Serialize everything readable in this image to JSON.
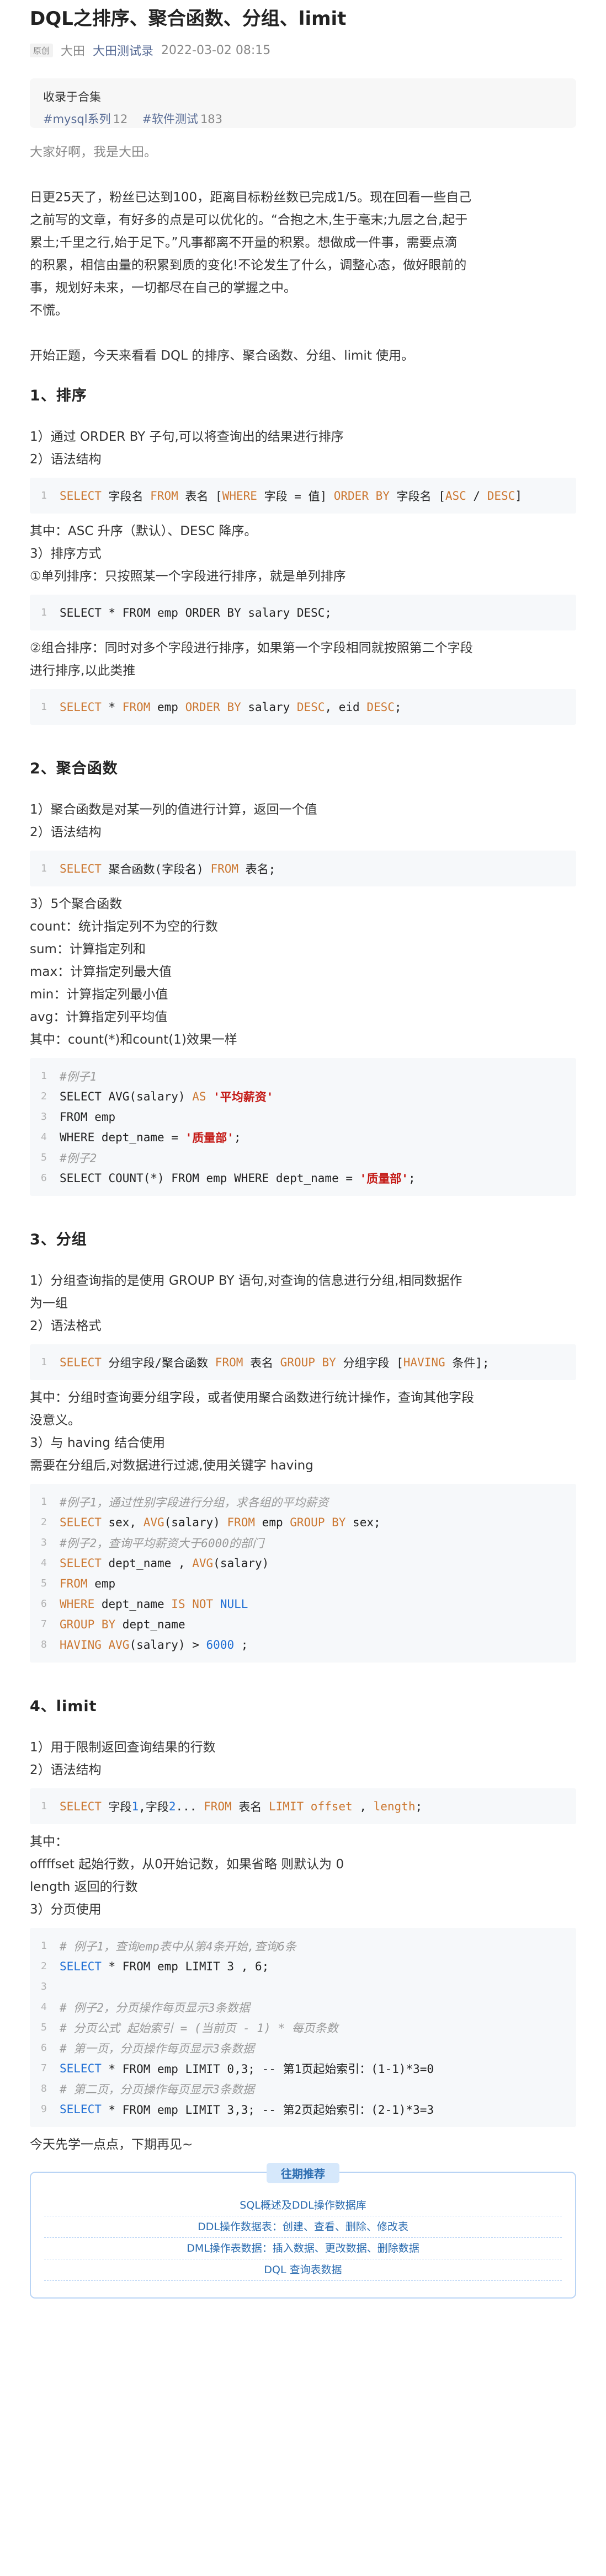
{
  "article": {
    "title": "DQL之排序、聚合函数、分组、limit",
    "badge": "原创",
    "author": "大田",
    "account": "大田测试录",
    "date": "2022-03-02 08:15"
  },
  "collection": {
    "label": "收录于合集",
    "tags": [
      {
        "name": "#mysql系列",
        "count": "12"
      },
      {
        "name": "#软件测试",
        "count": "183"
      }
    ]
  },
  "intro": {
    "greeting": "大家好啊，我是大田。",
    "para_lines": [
      "日更25天了，粉丝已达到100，距离目标粉丝数已完成1/5。现在回看一些自己",
      "之前写的文章，有好多的点是可以优化的。“合抱之木,生于毫末;九层之台,起于",
      "累土;千里之行,始于足下。”凡事都离不开量的积累。想做成一件事，需要点滴",
      "的积累，相信由量的积累到质的变化!不论发生了什么，调整心态，做好眼前的",
      "事，规划好未来，一切都尽在自己的掌握之中。"
    ],
    "closing": "不慌。",
    "start": "开始正题，今天来看看 DQL 的排序、聚合函数、分组、limit 使用。"
  },
  "s1": {
    "heading": "1、排序",
    "p1": "1）通过 ORDER BY 子句,可以将查询出的结果进行排序",
    "p2": "2）语法结构",
    "code1": {
      "n": "1",
      "a": "SELECT",
      "b": " 字段名 ",
      "c": "FROM",
      "d": " 表名 [",
      "e": "WHERE",
      "f": " 字段 = 值] ",
      "g": "ORDER BY",
      "h": " 字段名 [",
      "i": "ASC",
      "j": " / ",
      "k": "DESC",
      "l": "]"
    },
    "p3": "其中：ASC 升序（默认）、DESC 降序。",
    "p4": "3）排序方式",
    "p5": "①单列排序：只按照某一个字段进行排序，就是单列排序",
    "code2": {
      "n": "1",
      "a": "SELECT * FROM emp ORDER BY salary DESC;"
    },
    "p6a": "②组合排序：同时对多个字段进行排序，如果第一个字段相同就按照第二个字段",
    "p6b": "进行排序,以此类推",
    "code3": {
      "n": "1",
      "a": "SELECT",
      "b": " * ",
      "c": "FROM",
      "d": " emp ",
      "e": "ORDER BY",
      "f": " salary ",
      "g": "DESC",
      "h": ", eid ",
      "i": "DESC",
      "j": ";"
    }
  },
  "s2": {
    "heading": "2、聚合函数",
    "p1": "1）聚合函数是对某一列的值进行计算，返回一个值",
    "p2": "2）语法结构",
    "code1": {
      "n": "1",
      "a": "SELECT",
      "b": " 聚合函数(字段名) ",
      "c": "FROM",
      "d": " 表名;"
    },
    "list": [
      "3）5个聚合函数",
      "count：统计指定列不为空的行数",
      "sum：计算指定列和",
      "max：计算指定列最大值",
      "min：计算指定列最小值",
      "avg：计算指定列平均值",
      "其中：count(*)和count(1)效果一样"
    ],
    "code2": [
      {
        "n": "1",
        "cm": "#例子1"
      },
      {
        "n": "2",
        "a": "SELECT AVG(salary) ",
        "kw": "AS",
        "st": " '平均薪资'"
      },
      {
        "n": "3",
        "a": "FROM emp"
      },
      {
        "n": "4",
        "a": "WHERE dept_name = ",
        "st": "'质量部'",
        "z": ";"
      },
      {
        "n": "5",
        "cm": "#例子2"
      },
      {
        "n": "6",
        "a": "SELECT COUNT(*) FROM emp WHERE dept_name = ",
        "st": "'质量部'",
        "z": ";"
      }
    ]
  },
  "s3": {
    "heading": "3、分组",
    "p1a": "1）分组查询指的是使用 GROUP BY 语句,对查询的信息进行分组,相同数据作",
    "p1b": "为一组",
    "p2": "2）语法格式",
    "code1": {
      "n": "1",
      "a": "SELECT",
      "b": " 分组字段/聚合函数 ",
      "c": "FROM",
      "d": " 表名 ",
      "e": "GROUP BY",
      "f": " 分组字段 [",
      "g": "HAVING",
      "h": " 条件];"
    },
    "p3a": "其中：分组时查询要分组字段，或者使用聚合函数进行统计操作，查询其他字段",
    "p3b": "没意义。",
    "p4": "3）与 having 结合使用",
    "p5": "需要在分组后,对数据进行过滤,使用关键字 having",
    "code2": [
      {
        "n": "1",
        "cm": "#例子1，通过性别字段进行分组，求各组的平均薪资"
      },
      {
        "n": "2",
        "k1": "SELECT",
        "a": " sex, ",
        "k2": "AVG",
        "b": "(salary) ",
        "k3": "FROM",
        "c": " emp ",
        "k4": "GROUP BY",
        "d": " sex;"
      },
      {
        "n": "3",
        "cm": "#例子2，查询平均薪资大于6000的部门"
      },
      {
        "n": "4",
        "k1": "SELECT",
        "a": " dept_name , ",
        "k2": "AVG",
        "b": "(salary)"
      },
      {
        "n": "5",
        "k1": "FROM",
        "a": " emp"
      },
      {
        "n": "6",
        "k1": "WHERE",
        "a": " dept_name ",
        "k2": "IS NOT",
        "b": " ",
        "nu": "NULL"
      },
      {
        "n": "7",
        "k1": "GROUP BY",
        "a": " dept_name"
      },
      {
        "n": "8",
        "k1": "HAVING",
        "a": " ",
        "k2": "AVG",
        "b": "(salary) > ",
        "nu": "6000",
        "c": " ;"
      }
    ]
  },
  "s4": {
    "heading": "4、limit",
    "p1": "1）用于限制返回查询结果的行数",
    "p2": "2）语法结构",
    "code1": {
      "n": "1",
      "a": "SELECT",
      "b": " 字段",
      "c": "1",
      "d": ",字段",
      "e": "2",
      "f": "... ",
      "g": "FROM",
      "h": " 表名 ",
      "i": "LIMIT",
      "j": " offset ",
      "k": ",",
      "l": " length",
      "m": ";"
    },
    "list": [
      "其中：",
      "offffset 起始行数，从0开始记数，如果省略 则默认为 0",
      "length 返回的行数",
      "3）分页使用"
    ],
    "code2": [
      {
        "n": "1",
        "cm": "# 例子1，查询emp表中从第4条开始,查询6条"
      },
      {
        "n": "2",
        "kb": "SELECT",
        "a": " * FROM emp LIMIT 3 , 6;"
      },
      {
        "n": "3",
        "a": ""
      },
      {
        "n": "4",
        "cm": "# 例子2，分页操作每页显示3条数据"
      },
      {
        "n": "5",
        "cm": "# 分页公式 起始索引 = (当前页 - 1) * 每页条数"
      },
      {
        "n": "6",
        "cm": "# 第一页，分页操作每页显示3条数据"
      },
      {
        "n": "7",
        "kb": "SELECT",
        "a": " * FROM emp LIMIT 0,3; -- 第1页起始索引：(1-1)*3=0"
      },
      {
        "n": "8",
        "cm": "# 第二页，分页操作每页显示3条数据"
      },
      {
        "n": "9",
        "kb": "SELECT",
        "a": " * FROM emp LIMIT 3,3; -- 第2页起始索引：(2-1)*3=3"
      }
    ],
    "ending": "今天先学一点点，下期再见~"
  },
  "recommend": {
    "title": "往期推荐",
    "items": [
      "SQL概述及DDL操作数据库",
      "DDL操作数据表：创建、查看、删除、修改表",
      "DML操作表数据：插入数据、更改数据、删除数据",
      "DQL 查询表数据"
    ]
  }
}
